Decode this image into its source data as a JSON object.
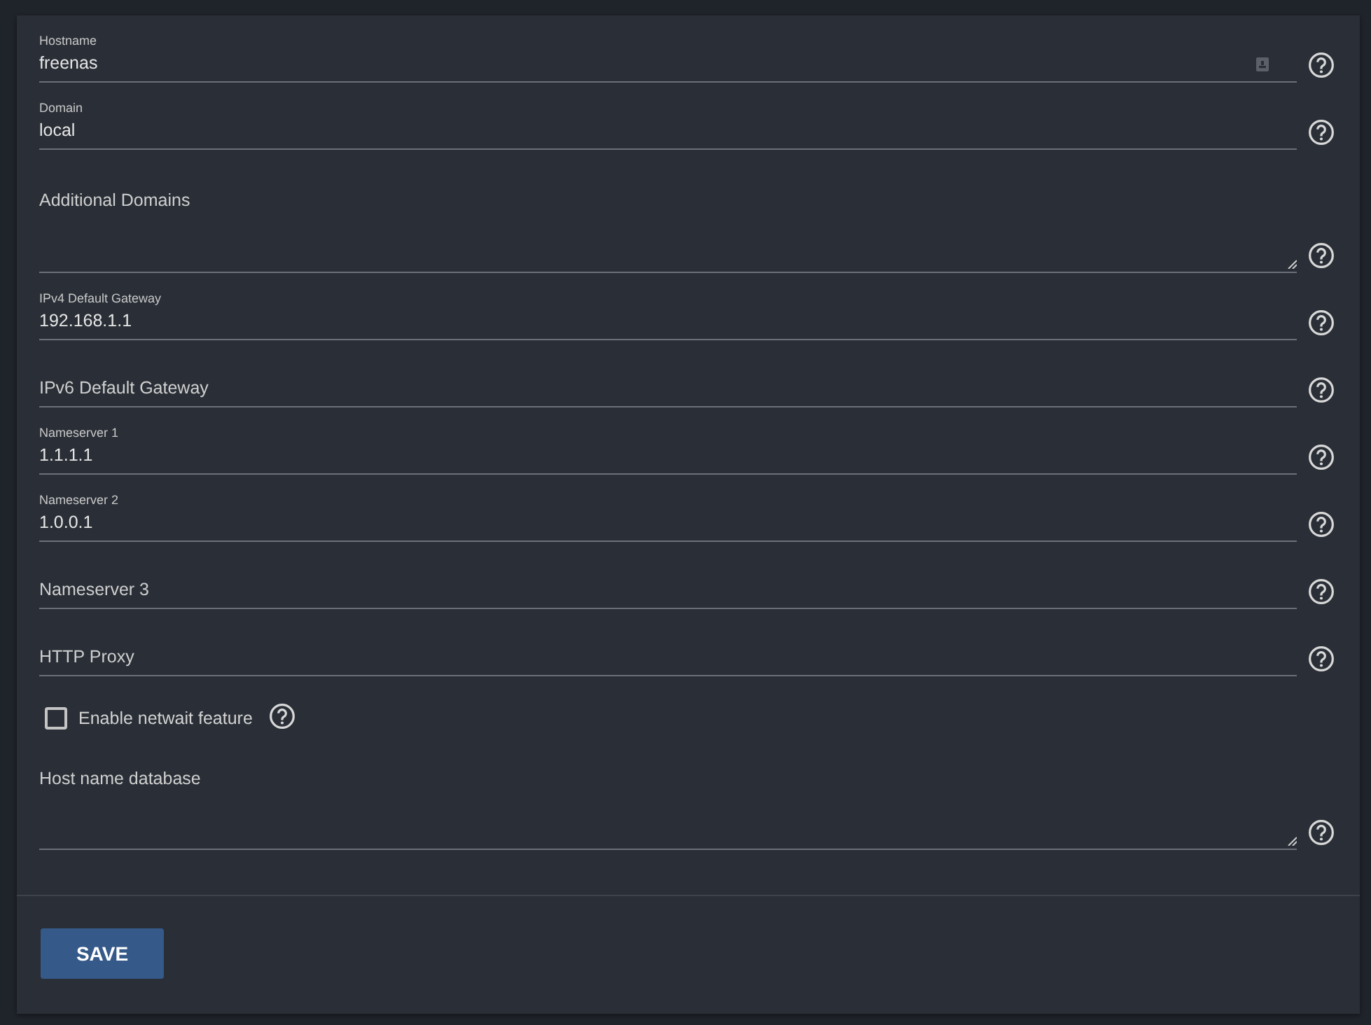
{
  "fields": [
    {
      "kind": "input",
      "label": "Hostname",
      "value": "freenas",
      "autofill": true
    },
    {
      "kind": "input",
      "label": "Domain",
      "value": "local"
    },
    {
      "kind": "textarea",
      "label": "Additional Domains"
    },
    {
      "kind": "input",
      "label": "IPv4 Default Gateway",
      "value": "192.168.1.1"
    },
    {
      "kind": "input",
      "label": "IPv6 Default Gateway"
    },
    {
      "kind": "input",
      "label": "Nameserver 1",
      "value": "1.1.1.1"
    },
    {
      "kind": "input",
      "label": "Nameserver 2",
      "value": "1.0.0.1"
    },
    {
      "kind": "input",
      "label": "Nameserver 3"
    },
    {
      "kind": "input",
      "label": "HTTP Proxy"
    },
    {
      "kind": "checkbox",
      "label": "Enable netwait feature",
      "checked": false
    },
    {
      "kind": "textarea",
      "label": "Host name database"
    }
  ],
  "save_button": "SAVE"
}
